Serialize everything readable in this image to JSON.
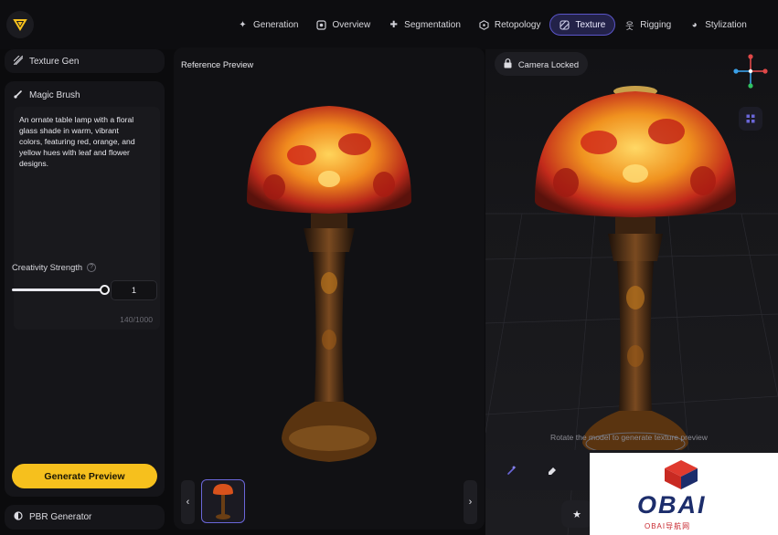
{
  "nav": {
    "tabs": [
      {
        "label": "Generation",
        "icon": "sparkle-icon"
      },
      {
        "label": "Overview",
        "icon": "target-icon"
      },
      {
        "label": "Segmentation",
        "icon": "puzzle-icon"
      },
      {
        "label": "Retopology",
        "icon": "mesh-icon"
      },
      {
        "label": "Texture",
        "icon": "texture-icon",
        "active": true
      },
      {
        "label": "Rigging",
        "icon": "figure-icon"
      },
      {
        "label": "Stylization",
        "icon": "palette-icon"
      }
    ],
    "active_color": "#5a55c9"
  },
  "left": {
    "texture_gen_label": "Texture Gen",
    "magic_brush_label": "Magic Brush",
    "prompt_text": "An ornate table lamp with a floral glass shade in warm, vibrant colors, featuring red, orange, and yellow hues with leaf and flower designs.",
    "char_count": "140/1000",
    "creativity_label": "Creativity Strength",
    "creativity_value": "1",
    "slider_fraction": 1.0,
    "generate_label": "Generate Preview",
    "generate_color": "#f6c01d",
    "pbr_label": "PBR Generator"
  },
  "reference": {
    "title": "Reference Preview",
    "prev_glyph": "‹",
    "next_glyph": "›"
  },
  "viewport": {
    "camera_label": "Camera Locked",
    "hint": "Rotate the model to generate texture preview"
  },
  "watermark": {
    "text": "OBAI",
    "sub": "OBAI导航网"
  }
}
